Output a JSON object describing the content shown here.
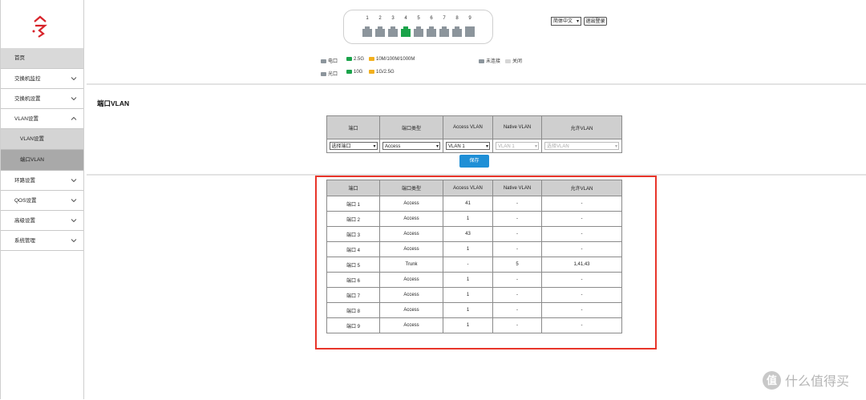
{
  "sidebar": {
    "items": [
      {
        "label": "首页"
      },
      {
        "label": "交换机监控"
      },
      {
        "label": "交换机设置"
      },
      {
        "label": "VLAN设置"
      },
      {
        "label": "VLAN设置"
      },
      {
        "label": "端口VLAN"
      },
      {
        "label": "环路设置"
      },
      {
        "label": "QOS设置"
      },
      {
        "label": "高级设置"
      },
      {
        "label": "系统管理"
      }
    ]
  },
  "header": {
    "ports": [
      "1",
      "2",
      "3",
      "4",
      "5",
      "6",
      "7",
      "8",
      "9"
    ],
    "active_port": "4",
    "language": "简体中文",
    "logout": "退出登录"
  },
  "legend": {
    "electric": "电口",
    "optical": "光口",
    "speed_25g": "2.5G",
    "speed_10m1000m": "10M/100M/1000M",
    "speed_10g": "10G",
    "speed_1g25g": "1G/2.5G",
    "disconnected": "未连接",
    "closed": "关闭"
  },
  "colors": {
    "green": "#1aa34a",
    "yellow": "#f2b01e",
    "port_gray": "#8c959c",
    "save_blue": "#1f8fd6",
    "highlight_red": "#e8352a"
  },
  "page": {
    "title": "端口VLAN",
    "save": "保存"
  },
  "columns": [
    "端口",
    "端口类型",
    "Access VLAN",
    "Native VLAN",
    "允许VLAN"
  ],
  "config_row": {
    "port": "选择端口",
    "type": "Access",
    "access_vlan": "VLAN 1",
    "native_vlan": "VLAN 1",
    "allowed_vlan": "选择VLAN"
  },
  "rows": [
    [
      "端口 1",
      "Access",
      "41",
      "-",
      "-"
    ],
    [
      "端口 2",
      "Access",
      "1",
      "-",
      "-"
    ],
    [
      "端口 3",
      "Access",
      "43",
      "-",
      "-"
    ],
    [
      "端口 4",
      "Access",
      "1",
      "-",
      "-"
    ],
    [
      "端口 5",
      "Trunk",
      "-",
      "5",
      "1,41,43"
    ],
    [
      "端口 6",
      "Access",
      "1",
      "-",
      "-"
    ],
    [
      "端口 7",
      "Access",
      "1",
      "-",
      "-"
    ],
    [
      "端口 8",
      "Access",
      "1",
      "-",
      "-"
    ],
    [
      "端口 9",
      "Access",
      "1",
      "-",
      "-"
    ]
  ],
  "watermark": {
    "logo": "值",
    "text": "什么值得买"
  }
}
